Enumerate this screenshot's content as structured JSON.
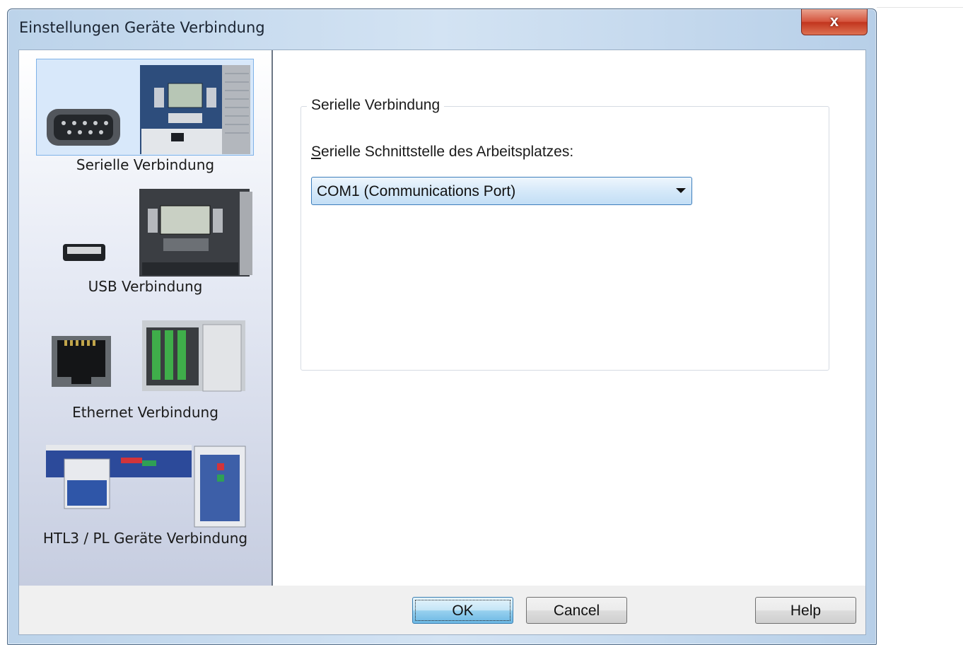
{
  "window": {
    "title": "Einstellungen Geräte Verbindung",
    "close_glyph": "x"
  },
  "sidebar": {
    "items": [
      {
        "label": "Serielle Verbindung",
        "icon": "serial-port-icon",
        "selected": true
      },
      {
        "label": "USB Verbindung",
        "icon": "usb-port-icon",
        "selected": false
      },
      {
        "label": "Ethernet Verbindung",
        "icon": "ethernet-port-icon",
        "selected": false
      },
      {
        "label": "HTL3 / PL Geräte Verbindung",
        "icon": "htl3-device-icon",
        "selected": false
      }
    ]
  },
  "main": {
    "group_title": "Serielle Verbindung",
    "port_label_accel": "S",
    "port_label_rest": "erielle Schnittstelle des Arbeitsplatzes:",
    "port_value": "COM1 (Communications Port)"
  },
  "footer": {
    "ok_label": "OK",
    "cancel_label": "Cancel",
    "help_label": "Help"
  }
}
